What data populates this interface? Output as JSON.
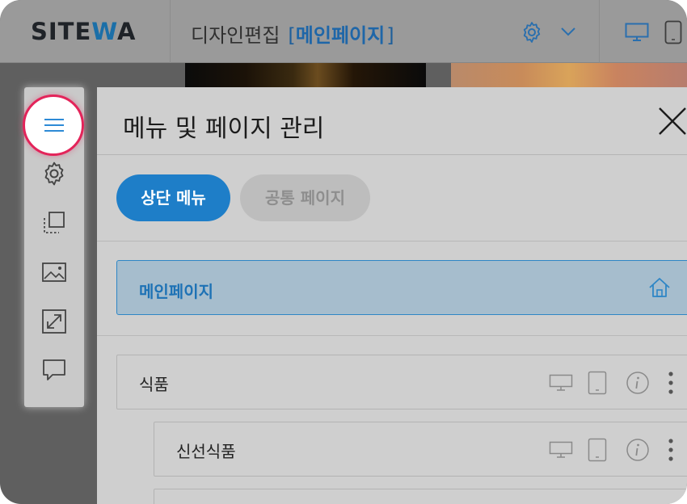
{
  "header": {
    "logo_prefix": "SITE",
    "logo_accent": "W",
    "logo_suffix": "A",
    "edit_label": "디자인편집",
    "bracket_open": "[",
    "current_page": "메인페이지",
    "bracket_close": "]"
  },
  "panel": {
    "title": "메뉴 및 페이지 관리",
    "tabs": [
      {
        "label": "상단 메뉴",
        "active": true
      },
      {
        "label": "공통 페이지",
        "active": false
      }
    ],
    "home_item": {
      "label": "메인페이지"
    },
    "menu_items": [
      {
        "label": "식품"
      },
      {
        "label": "신선식품"
      }
    ]
  },
  "colors": {
    "accent": "#1e7ec8",
    "highlight_ring": "#e3245a",
    "home_row_bg": "#a6bdcd"
  },
  "icons": {
    "toolbar": [
      "menu-icon",
      "gear-icon",
      "layers-icon",
      "image-icon",
      "resize-icon",
      "comment-icon"
    ],
    "header": [
      "gear-icon",
      "chevron-down-icon",
      "desktop-icon",
      "tablet-icon"
    ],
    "row": [
      "desktop-icon",
      "tablet-icon",
      "info-icon",
      "more-icon"
    ]
  }
}
